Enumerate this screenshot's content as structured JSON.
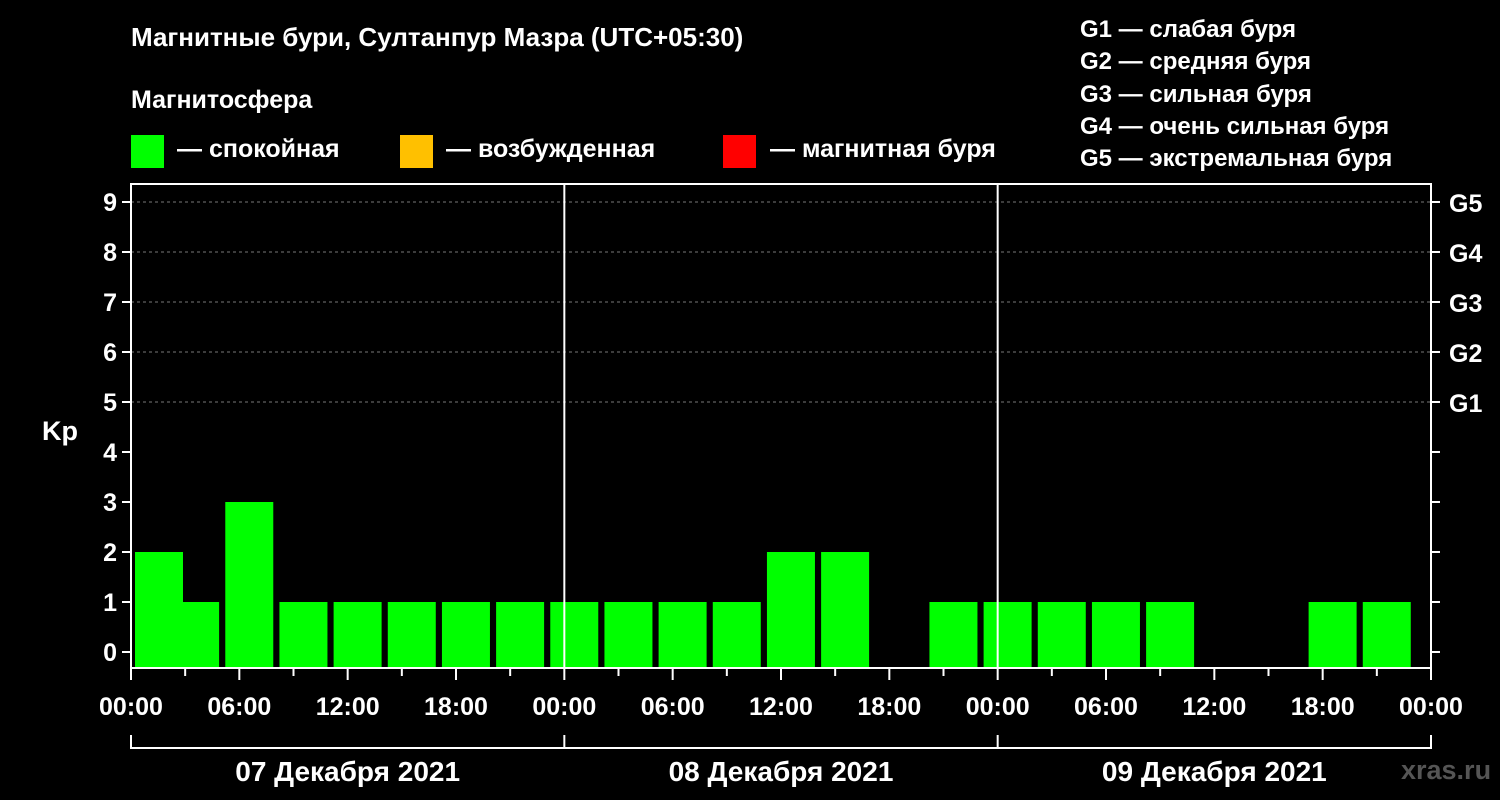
{
  "header": {
    "title": "Магнитные бури, Султанпур Мазра (UTC+05:30)",
    "legend_title": "Магнитосфера",
    "legend": [
      {
        "label": "— спокойная",
        "color": "#00ff00"
      },
      {
        "label": "— возбужденная",
        "color": "#ffc000"
      },
      {
        "label": "— магнитная буря",
        "color": "#ff0000"
      }
    ],
    "g_scale": [
      "G1 — слабая буря",
      "G2 — средняя буря",
      "G3 — сильная буря",
      "G4 — очень сильная буря",
      "G5 — экстремальная буря"
    ]
  },
  "watermark": "xras.ru",
  "chart_data": {
    "type": "bar",
    "ylabel": "Kp",
    "ylim": [
      0,
      9
    ],
    "y_ticks": [
      "0",
      "1",
      "2",
      "3",
      "4",
      "5",
      "6",
      "7",
      "8",
      "9"
    ],
    "g_axis": [
      {
        "kp": 5,
        "label": "G1"
      },
      {
        "kp": 6,
        "label": "G2"
      },
      {
        "kp": 7,
        "label": "G3"
      },
      {
        "kp": 8,
        "label": "G4"
      },
      {
        "kp": 9,
        "label": "G5"
      }
    ],
    "x_tick_labels": [
      "00:00",
      "06:00",
      "12:00",
      "18:00",
      "00:00",
      "06:00",
      "12:00",
      "18:00",
      "00:00",
      "06:00",
      "12:00",
      "18:00",
      "00:00"
    ],
    "days": [
      "07 Декабря 2021",
      "08 Декабря 2021",
      "09 Декабря 2021"
    ],
    "bar_color": "#00ff00",
    "bars": [
      {
        "day": 0,
        "start": "00:00",
        "kp": 2
      },
      {
        "day": 0,
        "start": "02:00",
        "kp": 1
      },
      {
        "day": 0,
        "start": "05:00",
        "kp": 3
      },
      {
        "day": 0,
        "start": "08:00",
        "kp": 1
      },
      {
        "day": 0,
        "start": "11:00",
        "kp": 1
      },
      {
        "day": 0,
        "start": "14:00",
        "kp": 1
      },
      {
        "day": 0,
        "start": "17:00",
        "kp": 1
      },
      {
        "day": 0,
        "start": "20:00",
        "kp": 1
      },
      {
        "day": 0,
        "start": "23:00",
        "kp": 1
      },
      {
        "day": 1,
        "start": "02:00",
        "kp": 1
      },
      {
        "day": 1,
        "start": "05:00",
        "kp": 1
      },
      {
        "day": 1,
        "start": "08:00",
        "kp": 1
      },
      {
        "day": 1,
        "start": "11:00",
        "kp": 2
      },
      {
        "day": 1,
        "start": "14:00",
        "kp": 2
      },
      {
        "day": 1,
        "start": "20:00",
        "kp": 1
      },
      {
        "day": 1,
        "start": "23:00",
        "kp": 1
      },
      {
        "day": 2,
        "start": "02:00",
        "kp": 1
      },
      {
        "day": 2,
        "start": "05:00",
        "kp": 1
      },
      {
        "day": 2,
        "start": "08:00",
        "kp": 1
      },
      {
        "day": 2,
        "start": "17:00",
        "kp": 1
      },
      {
        "day": 2,
        "start": "20:00",
        "kp": 1
      }
    ]
  }
}
